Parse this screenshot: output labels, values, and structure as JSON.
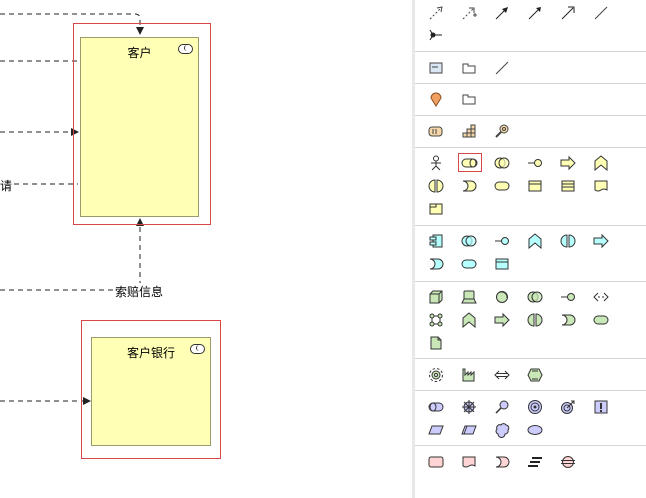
{
  "diagram": {
    "nodes": [
      {
        "id": "customer",
        "title": "客户",
        "icon": "actor-role-icon"
      },
      {
        "id": "bank",
        "title": "客户银行",
        "icon": "actor-role-icon"
      }
    ],
    "edge_labels": {
      "left_text": "请",
      "claim_info": "索赔信息"
    }
  },
  "palette": {
    "selected_tool": "business-role-tool",
    "sections": [
      [
        "relation-dashed-arrow",
        "relation-dashed-plus-arrow",
        "relation-solid-arrow",
        "relation-filled-arrow",
        "relation-open-arrow",
        "relation-line",
        "junction"
      ],
      [
        "note",
        "group",
        "line"
      ],
      [
        "location",
        "grouping"
      ],
      [
        "battery-resource",
        "capability",
        "value-stream-search"
      ],
      [
        "business-actor",
        "business-role",
        "business-collaboration",
        "business-interface",
        "business-process",
        "business-function",
        "business-interaction",
        "business-event",
        "business-service",
        "business-object",
        "contract",
        "representation",
        "product"
      ],
      [
        "application-component",
        "application-collaboration",
        "application-interface",
        "application-function",
        "application-interaction",
        "application-process",
        "application-event",
        "application-service",
        "data-object"
      ],
      [
        "node",
        "device",
        "system-software",
        "technology-collaboration",
        "technology-interface",
        "path",
        "communication-network",
        "technology-function",
        "technology-process",
        "technology-interaction",
        "technology-event",
        "technology-service",
        "artifact"
      ],
      [
        "equipment",
        "facility",
        "distribution-network",
        "material"
      ],
      [
        "stakeholder",
        "driver",
        "assessment",
        "goal",
        "outcome",
        "principle",
        "requirement",
        "constraint",
        "meaning",
        "value"
      ],
      [
        "work-package",
        "deliverable",
        "implementation-event",
        "plateau",
        "gap"
      ]
    ]
  }
}
